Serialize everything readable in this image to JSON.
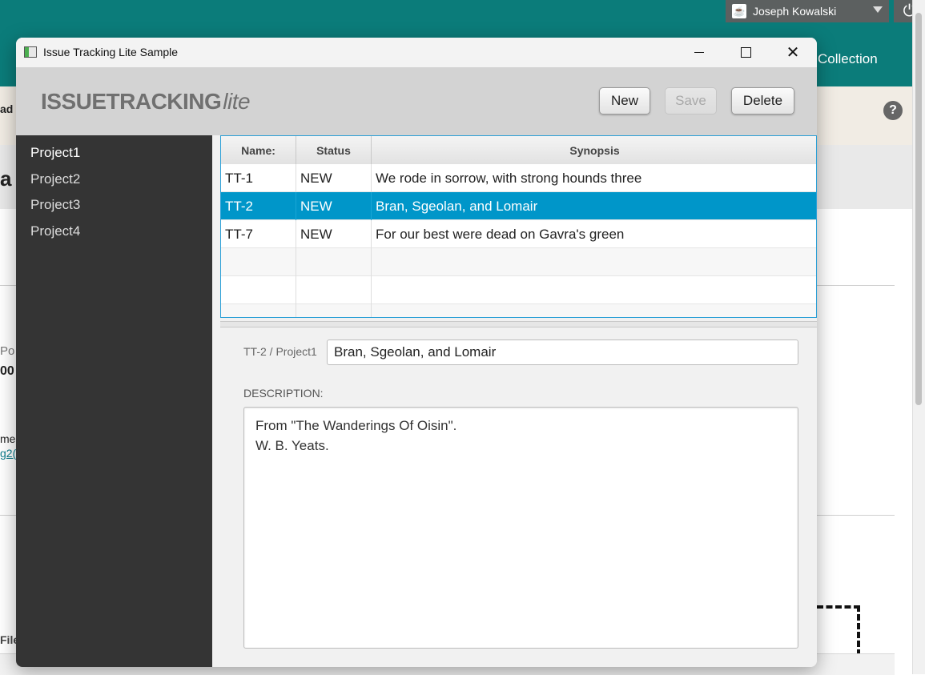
{
  "background": {
    "user_name": "Joseph Kowalski",
    "collection_link": "Collection",
    "help_icon": "?",
    "fragment_left_top": "ad .",
    "fragment_heading": "a",
    "fragment_po": "Po",
    "fragment_00": "00",
    "fragment_me": "me",
    "fragment_link": "g2(",
    "fragment_file": "File"
  },
  "window": {
    "title": "Issue Tracking Lite Sample"
  },
  "header": {
    "logo_main": "ISSUETRACKING",
    "logo_suffix": "lite",
    "new_label": "New",
    "save_label": "Save",
    "delete_label": "Delete"
  },
  "sidebar": {
    "projects": [
      "Project1",
      "Project2",
      "Project3",
      "Project4"
    ],
    "selected": "Project1"
  },
  "table": {
    "columns": [
      "Name:",
      "Status",
      "Synopsis"
    ],
    "rows": [
      {
        "name": "TT-1",
        "status": "NEW",
        "synopsis": "We rode in sorrow, with strong hounds three"
      },
      {
        "name": "TT-2",
        "status": "NEW",
        "synopsis": "Bran, Sgeolan, and Lomair"
      },
      {
        "name": "TT-7",
        "status": "NEW",
        "synopsis": "For our best were dead on Gavra's green"
      }
    ],
    "selected_row": "TT-2"
  },
  "detail": {
    "id_label": "TT-2 / Project1",
    "synopsis_value": "Bran, Sgeolan, and Lomair",
    "description_label": "DESCRIPTION:",
    "description_lines": [
      "From \"The Wanderings Of Oisin\".",
      "W. B. Yeats."
    ]
  },
  "colors": {
    "teal_header": "#0b7c7a",
    "sidebar_bg": "#343434",
    "selection": "#0096c9"
  }
}
